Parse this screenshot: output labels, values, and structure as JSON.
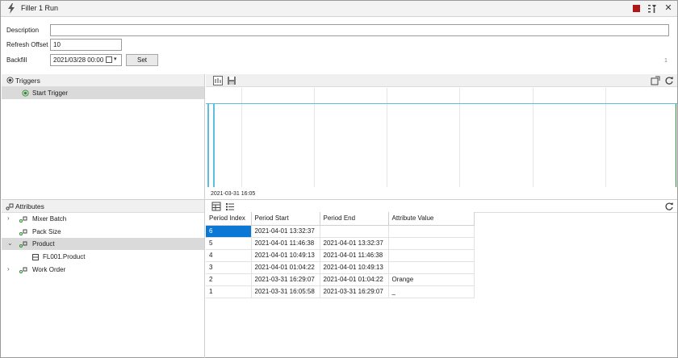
{
  "window": {
    "title": "Filler 1 Run"
  },
  "form": {
    "description_label": "Description",
    "description_value": "",
    "refresh_offset_label": "Refresh Offset",
    "refresh_offset_value": "10",
    "backfill_label": "Backfill",
    "backfill_value": "2021/03/28 00:00",
    "set_label": "Set",
    "page_number": "1"
  },
  "triggers": {
    "title": "Triggers",
    "items": [
      {
        "label": "Start Trigger",
        "icon": "trigger-icon"
      }
    ]
  },
  "chart": {
    "timestamp": "2021-03-31 16:05",
    "accent_color": "#5bc0e0",
    "end_marker_color": "#2e8b2e"
  },
  "attributes": {
    "title": "Attributes",
    "items": [
      {
        "label": "Mixer Batch",
        "expandable": true,
        "expanded": false
      },
      {
        "label": "Pack Size",
        "expandable": false,
        "expanded": false
      },
      {
        "label": "Product",
        "expandable": true,
        "expanded": true
      },
      {
        "label": "FL001.Product",
        "child": true
      },
      {
        "label": "Work Order",
        "expandable": true,
        "expanded": false
      }
    ]
  },
  "grid": {
    "columns": [
      "Period Index",
      "Period Start",
      "Period End",
      "Attribute Value"
    ],
    "rows": [
      [
        "6",
        "2021-04-01 13:32:37",
        "",
        ""
      ],
      [
        "5",
        "2021-04-01 11:46:38",
        "2021-04-01 13:32:37",
        ""
      ],
      [
        "4",
        "2021-04-01 10:49:13",
        "2021-04-01 11:46:38",
        ""
      ],
      [
        "3",
        "2021-04-01 01:04:22",
        "2021-04-01 10:49:13",
        ""
      ],
      [
        "2",
        "2021-03-31 16:29:07",
        "2021-04-01 01:04:22",
        "Orange"
      ],
      [
        "1",
        "2021-03-31 16:05:58",
        "2021-03-31 16:29:07",
        "_"
      ]
    ],
    "selected_color": "#0a78d4"
  }
}
